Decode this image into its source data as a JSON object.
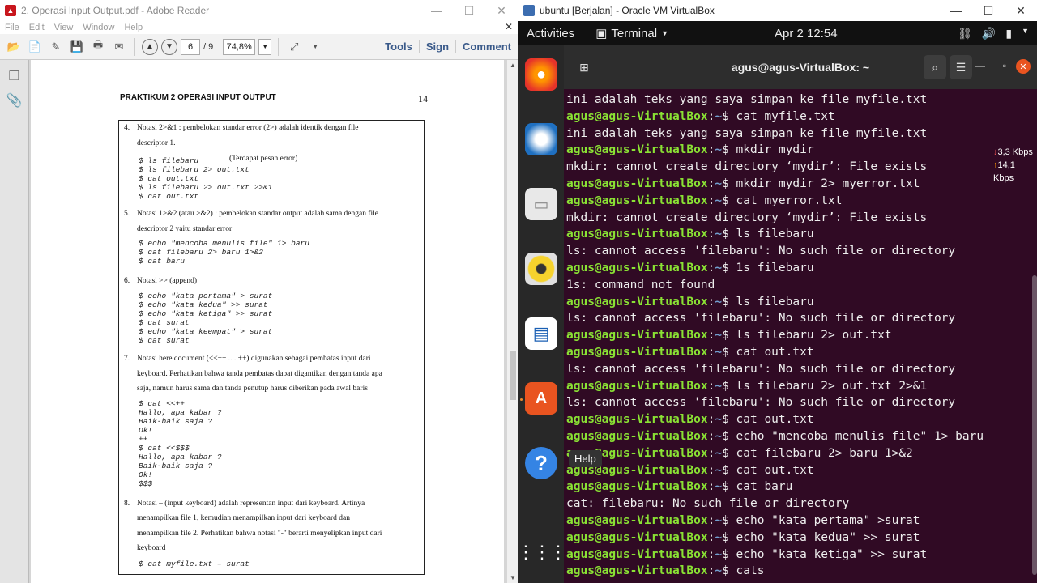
{
  "reader": {
    "title": "2. Operasi Input Output.pdf - Adobe Reader",
    "menu": [
      "File",
      "Edit",
      "View",
      "Window",
      "Help"
    ],
    "page_current": "6",
    "page_total": "/ 9",
    "zoom": "74,8%",
    "tools": "Tools",
    "sign": "Sign",
    "comment": "Comment",
    "doc": {
      "header": "PRAKTIKUM 2 OPERASI INPUT OUTPUT",
      "page_num": "14",
      "i4_num": "4.",
      "i4_a": "Notasi 2>&1 : pembelokan standar error (2>) adalah identik dengan file",
      "i4_b": "descriptor 1.",
      "i4_code": "$ ls filebaru\n$ ls filebaru 2> out.txt\n$ cat out.txt\n$ ls filebaru 2> out.txt 2>&1\n$ cat out.txt",
      "i4_note": "(Terdapat pesan error)",
      "i5_num": "5.",
      "i5_a": "Notasi 1>&2 (atau >&2) : pembelokan standar output adalah sama dengan file",
      "i5_b": "descriptor 2 yaitu standar error",
      "i5_code": "$ echo \"mencoba menulis file\" 1> baru\n$ cat filebaru 2> baru 1>&2\n$ cat baru",
      "i6_num": "6.",
      "i6_a": "Notasi >> (append)",
      "i6_code": "$ echo \"kata pertama\" > surat\n$ echo \"kata kedua\" >> surat\n$ echo \"kata ketiga\" >> surat\n$ cat surat\n$ echo \"kata keempat\" > surat\n$ cat surat",
      "i7_num": "7.",
      "i7_a": "Notasi here document (<<++ .... ++) digunakan sebagai pembatas input dari",
      "i7_b": "keyboard.  Perhatikan bahwa tanda pembatas dapat digantikan dengan tanda apa",
      "i7_c": "saja, namun harus sama dan tanda penutup harus diberikan pada awal baris",
      "i7_code": "$ cat <<++\nHallo, apa kabar ?\nBaik-baik saja ?\nOk!\n++\n$ cat <<$$$\nHallo, apa kabar ?\nBaik-baik saja ?\nOk!\n$$$",
      "i8_num": "8.",
      "i8_a": "Notasi – (input keyboard) adalah representan input dari keyboard.  Artinya",
      "i8_b": "menampilkan file 1, kemudian menampilkan input dari keyboard dan",
      "i8_c": "menampilkan file 2.  Perhatikan bahwa notasi \"-\" berarti menyelipkan input dari",
      "i8_d": "keyboard",
      "i8_code": "$ cat myfile.txt – surat"
    }
  },
  "vm": {
    "title": "ubuntu [Berjalan] - Oracle VM VirtualBox",
    "activities": "Activities",
    "app_menu": "Terminal",
    "clock": "Apr 2  12:54",
    "terminal_title": "agus@agus-VirtualBox: ~",
    "help_tooltip": "Help",
    "net_down": "3,3 Kbps",
    "net_up": "14,1 Kbps",
    "prompt_user": "agus@agus-VirtualBox",
    "prompt_dir": "~",
    "lines": [
      {
        "t": "out",
        "text": "ini adalah teks yang saya simpan ke file myfile.txt"
      },
      {
        "t": "cmd",
        "text": "cat myfile.txt"
      },
      {
        "t": "out",
        "text": "ini adalah teks yang saya simpan ke file myfile.txt"
      },
      {
        "t": "cmd",
        "text": "mkdir mydir"
      },
      {
        "t": "out",
        "text": "mkdir: cannot create directory ‘mydir’: File exists"
      },
      {
        "t": "cmd",
        "text": "mkdir mydir 2> myerror.txt"
      },
      {
        "t": "cmd",
        "text": "cat myerror.txt"
      },
      {
        "t": "out",
        "text": "mkdir: cannot create directory ‘mydir’: File exists"
      },
      {
        "t": "cmd",
        "text": "ls filebaru"
      },
      {
        "t": "out",
        "text": "ls: cannot access 'filebaru': No such file or directory"
      },
      {
        "t": "cmd",
        "text": "1s filebaru"
      },
      {
        "t": "out",
        "text": "1s: command not found"
      },
      {
        "t": "cmd",
        "text": "ls filebaru"
      },
      {
        "t": "out",
        "text": "ls: cannot access 'filebaru': No such file or directory"
      },
      {
        "t": "cmd",
        "text": "ls filebaru 2> out.txt"
      },
      {
        "t": "cmd",
        "text": "cat out.txt"
      },
      {
        "t": "out",
        "text": "ls: cannot access 'filebaru': No such file or directory"
      },
      {
        "t": "cmd",
        "text": "ls filebaru 2> out.txt 2>&1"
      },
      {
        "t": "out",
        "text": "ls: cannot access 'filebaru': No such file or directory"
      },
      {
        "t": "cmd",
        "text": "cat out.txt"
      },
      {
        "t": "cmd",
        "text": "echo \"mencoba menulis file\" 1> baru"
      },
      {
        "t": "cmd",
        "text": "cat filebaru 2> baru 1>&2"
      },
      {
        "t": "cmd",
        "text": "cat out.txt"
      },
      {
        "t": "cmd",
        "text": "cat baru"
      },
      {
        "t": "out",
        "text": "cat: filebaru: No such file or directory"
      },
      {
        "t": "cmd",
        "text": "echo \"kata pertama\" >surat"
      },
      {
        "t": "cmd",
        "text": "echo \"kata kedua\" >> surat"
      },
      {
        "t": "cmd",
        "text": "echo \"kata ketiga\" >> surat"
      },
      {
        "t": "cmd",
        "text": "cats"
      }
    ],
    "colors": {
      "terminal_bg": "#300a24",
      "prompt_user": "#8ae234",
      "prompt_dir": "#729fcf",
      "accent": "#e95420"
    }
  }
}
